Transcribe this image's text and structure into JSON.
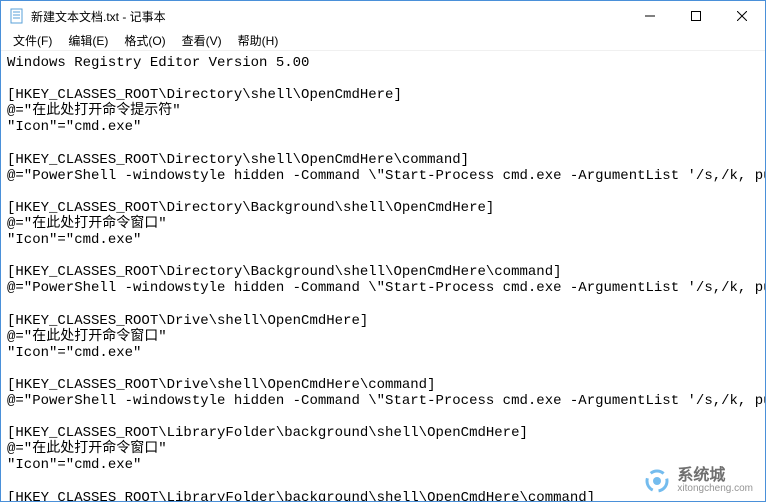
{
  "window": {
    "title": "新建文本文档.txt - 记事本"
  },
  "menu": {
    "file": "文件(F)",
    "edit": "编辑(E)",
    "format": "格式(O)",
    "view": "查看(V)",
    "help": "帮助(H)"
  },
  "content": {
    "lines": [
      "Windows Registry Editor Version 5.00",
      "",
      "[HKEY_CLASSES_ROOT\\Directory\\shell\\OpenCmdHere]",
      "@=\"在此处打开命令提示符\"",
      "\"Icon\"=\"cmd.exe\"",
      "",
      "[HKEY_CLASSES_ROOT\\Directory\\shell\\OpenCmdHere\\command]",
      "@=\"PowerShell -windowstyle hidden -Command \\\"Start-Process cmd.exe -ArgumentList '/s,/k, push",
      "",
      "[HKEY_CLASSES_ROOT\\Directory\\Background\\shell\\OpenCmdHere]",
      "@=\"在此处打开命令窗口\"",
      "\"Icon\"=\"cmd.exe\"",
      "",
      "[HKEY_CLASSES_ROOT\\Directory\\Background\\shell\\OpenCmdHere\\command]",
      "@=\"PowerShell -windowstyle hidden -Command \\\"Start-Process cmd.exe -ArgumentList '/s,/k, push",
      "",
      "[HKEY_CLASSES_ROOT\\Drive\\shell\\OpenCmdHere]",
      "@=\"在此处打开命令窗口\"",
      "\"Icon\"=\"cmd.exe\"",
      "",
      "[HKEY_CLASSES_ROOT\\Drive\\shell\\OpenCmdHere\\command]",
      "@=\"PowerShell -windowstyle hidden -Command \\\"Start-Process cmd.exe -ArgumentList '/s,/k, push",
      "",
      "[HKEY_CLASSES_ROOT\\LibraryFolder\\background\\shell\\OpenCmdHere]",
      "@=\"在此处打开命令窗口\"",
      "\"Icon\"=\"cmd.exe\"",
      "",
      "[HKEY_CLASSES_ROOT\\LibraryFolder\\background\\shell\\OpenCmdHere\\command]"
    ]
  },
  "watermark": {
    "cn": "系统城",
    "url": "xitongcheng.com"
  }
}
